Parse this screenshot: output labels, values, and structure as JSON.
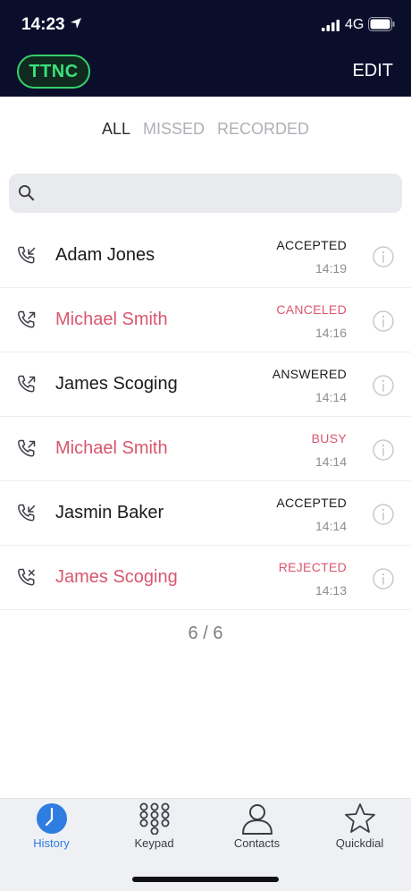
{
  "status_bar": {
    "time": "14:23",
    "network": "4G"
  },
  "header": {
    "brand": "TTNC",
    "edit_label": "EDIT"
  },
  "filters": [
    {
      "label": "ALL",
      "active": true
    },
    {
      "label": "MISSED",
      "active": false
    },
    {
      "label": "RECORDED",
      "active": false
    }
  ],
  "search": {
    "placeholder": ""
  },
  "calls": [
    {
      "name": "Adam Jones",
      "status": "ACCEPTED",
      "time": "14:19",
      "direction": "incoming",
      "bad": false
    },
    {
      "name": "Michael Smith",
      "status": "CANCELED",
      "time": "14:16",
      "direction": "outgoing",
      "bad": true
    },
    {
      "name": "James Scoging",
      "status": "ANSWERED",
      "time": "14:14",
      "direction": "outgoing",
      "bad": false
    },
    {
      "name": "Michael Smith",
      "status": "BUSY",
      "time": "14:14",
      "direction": "outgoing",
      "bad": true
    },
    {
      "name": "Jasmin Baker",
      "status": "ACCEPTED",
      "time": "14:14",
      "direction": "incoming",
      "bad": false
    },
    {
      "name": "James Scoging",
      "status": "REJECTED",
      "time": "14:13",
      "direction": "rejected",
      "bad": true
    }
  ],
  "counter": "6 / 6",
  "tabs": [
    {
      "label": "History",
      "icon": "clock-icon",
      "active": true
    },
    {
      "label": "Keypad",
      "icon": "keypad-icon",
      "active": false
    },
    {
      "label": "Contacts",
      "icon": "person-icon",
      "active": false
    },
    {
      "label": "Quickdial",
      "icon": "star-icon",
      "active": false
    }
  ],
  "colors": {
    "header_bg": "#0b0e2b",
    "brand_green": "#3be07a",
    "alert_red": "#d9566e",
    "accent_blue": "#2f7de1"
  }
}
